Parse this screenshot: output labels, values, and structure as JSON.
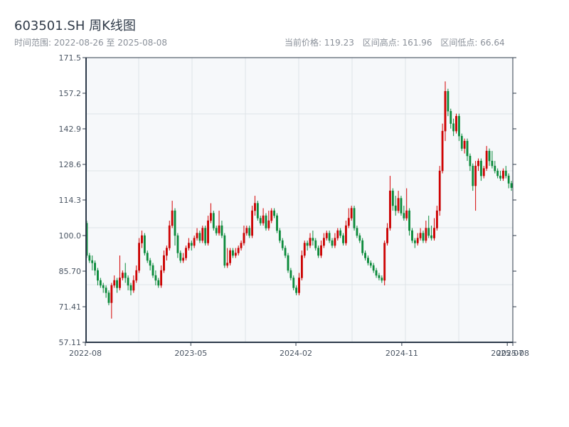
{
  "header": {
    "title": "603501.SH 周K线图",
    "range_label": "时间范围: 2022-08-26 至 2025-08-08",
    "current_price": "当前价格: 119.23",
    "range_high": "区间高点: 161.96",
    "range_low": "区间低点: 66.64"
  },
  "colors": {
    "up": "#d40000",
    "down": "#0a8a3a",
    "plot_bg": "#f6f8fa",
    "axis": "#2d3a4a",
    "grid": "#dfe3e8"
  },
  "chart_data": {
    "type": "candlestick",
    "title": "603501.SH 周K线图",
    "start_date": "2022-08-26",
    "end_date": "2025-08-08",
    "ylim": [
      57.11,
      171.5
    ],
    "y_ticks": [
      "171.5",
      "157.2",
      "142.9",
      "128.6",
      "114.3",
      "100.0",
      "85.70",
      "71.41",
      "57.11"
    ],
    "x_ticks": [
      {
        "label": "2022-08",
        "date": "2022-08-26"
      },
      {
        "label": "2023-05",
        "date": "2023-05-19"
      },
      {
        "label": "2024-02",
        "date": "2024-02-08"
      },
      {
        "label": "2024-11",
        "date": "2024-11-01"
      },
      {
        "label": "2025-07",
        "date": "2025-07-25"
      },
      {
        "label": "2025-08",
        "date": "2025-08-08"
      }
    ],
    "grid": true,
    "ohlc_format": [
      "open",
      "close",
      "low",
      "high"
    ],
    "candles": [
      [
        105,
        92,
        91,
        106
      ],
      [
        92,
        90,
        89,
        93
      ],
      [
        90,
        89,
        86,
        92
      ],
      [
        89,
        86,
        84,
        90
      ],
      [
        86,
        82,
        80,
        87
      ],
      [
        82,
        80,
        79,
        83
      ],
      [
        80,
        79,
        77,
        81
      ],
      [
        79,
        77,
        75,
        80
      ],
      [
        77,
        73,
        72,
        78
      ],
      [
        73,
        80,
        66.64,
        81
      ],
      [
        80,
        82,
        79,
        84
      ],
      [
        82,
        79,
        77,
        83
      ],
      [
        79,
        83,
        78,
        92
      ],
      [
        83,
        85,
        82,
        86
      ],
      [
        85,
        83,
        81,
        89
      ],
      [
        83,
        80,
        78,
        84
      ],
      [
        80,
        78,
        76,
        81
      ],
      [
        78,
        82,
        77,
        84
      ],
      [
        82,
        86,
        81,
        88
      ],
      [
        86,
        97,
        85,
        99
      ],
      [
        97,
        100,
        95,
        102
      ],
      [
        100,
        93,
        92,
        101
      ],
      [
        93,
        90,
        89,
        94
      ],
      [
        90,
        88,
        86,
        91
      ],
      [
        88,
        84,
        83,
        89
      ],
      [
        84,
        82,
        80,
        86
      ],
      [
        82,
        80,
        79,
        83
      ],
      [
        80,
        86,
        79,
        88
      ],
      [
        86,
        92,
        85,
        94
      ],
      [
        92,
        95,
        90,
        96
      ],
      [
        95,
        104,
        94,
        106
      ],
      [
        104,
        110,
        103,
        114
      ],
      [
        110,
        100,
        96,
        111
      ],
      [
        100,
        93,
        91,
        101
      ],
      [
        93,
        90,
        89,
        94
      ],
      [
        90,
        91,
        89,
        93
      ],
      [
        91,
        95,
        90,
        96
      ],
      [
        95,
        97,
        94,
        99
      ],
      [
        97,
        96,
        94,
        98
      ],
      [
        96,
        99,
        95,
        100
      ],
      [
        99,
        101,
        98,
        103
      ],
      [
        101,
        98,
        97,
        102
      ],
      [
        98,
        103,
        97,
        104
      ],
      [
        103,
        97,
        96,
        104
      ],
      [
        97,
        106,
        96,
        108
      ],
      [
        106,
        109,
        105,
        113
      ],
      [
        109,
        103,
        102,
        110
      ],
      [
        103,
        101,
        100,
        104
      ],
      [
        101,
        104,
        100,
        110
      ],
      [
        104,
        100,
        99,
        106
      ],
      [
        100,
        88,
        87,
        101
      ],
      [
        88,
        89,
        87,
        95
      ],
      [
        89,
        94,
        88,
        95
      ],
      [
        94,
        92,
        91,
        95
      ],
      [
        92,
        93,
        91,
        95
      ],
      [
        93,
        95,
        92,
        96
      ],
      [
        95,
        97,
        94,
        98
      ],
      [
        97,
        101,
        96,
        104
      ],
      [
        101,
        103,
        100,
        104
      ],
      [
        103,
        100,
        99,
        104
      ],
      [
        100,
        110,
        99,
        112
      ],
      [
        110,
        113,
        108,
        116
      ],
      [
        113,
        107,
        106,
        114
      ],
      [
        107,
        105,
        104,
        108
      ],
      [
        105,
        108,
        104,
        111
      ],
      [
        108,
        103,
        102,
        109
      ],
      [
        103,
        106,
        102,
        110
      ],
      [
        106,
        110,
        105,
        111
      ],
      [
        110,
        108,
        107,
        111
      ],
      [
        108,
        102,
        101,
        109
      ],
      [
        102,
        98,
        97,
        103
      ],
      [
        98,
        95,
        94,
        99
      ],
      [
        95,
        92,
        91,
        96
      ],
      [
        92,
        86,
        85,
        93
      ],
      [
        86,
        83,
        82,
        87
      ],
      [
        83,
        79,
        78,
        84
      ],
      [
        79,
        77,
        76,
        80
      ],
      [
        77,
        83,
        76,
        85
      ],
      [
        83,
        92,
        82,
        94
      ],
      [
        92,
        97,
        91,
        98
      ],
      [
        97,
        96,
        94,
        98
      ],
      [
        96,
        99,
        95,
        101
      ],
      [
        99,
        98,
        96,
        102
      ],
      [
        98,
        95,
        94,
        99
      ],
      [
        95,
        92,
        91,
        96
      ],
      [
        92,
        96,
        91,
        98
      ],
      [
        96,
        99,
        95,
        101
      ],
      [
        99,
        101,
        98,
        102
      ],
      [
        101,
        98,
        97,
        102
      ],
      [
        98,
        96,
        95,
        99
      ],
      [
        96,
        99,
        95,
        101
      ],
      [
        99,
        102,
        98,
        103
      ],
      [
        102,
        100,
        99,
        103
      ],
      [
        100,
        97,
        96,
        101
      ],
      [
        97,
        104,
        96,
        106
      ],
      [
        104,
        107,
        103,
        111
      ],
      [
        107,
        111,
        106,
        112
      ],
      [
        111,
        103,
        102,
        112
      ],
      [
        103,
        100,
        99,
        104
      ],
      [
        100,
        98,
        97,
        101
      ],
      [
        98,
        93,
        92,
        99
      ],
      [
        93,
        91,
        90,
        94
      ],
      [
        91,
        89,
        88,
        92
      ],
      [
        89,
        88,
        87,
        90
      ],
      [
        88,
        86,
        85,
        89
      ],
      [
        86,
        84,
        83,
        87
      ],
      [
        84,
        83,
        82,
        85
      ],
      [
        83,
        82,
        81,
        84
      ],
      [
        82,
        97,
        80,
        98
      ],
      [
        97,
        103,
        96,
        105
      ],
      [
        103,
        118,
        102,
        124
      ],
      [
        118,
        112,
        110,
        119
      ],
      [
        112,
        110,
        108,
        116
      ],
      [
        110,
        115,
        109,
        118
      ],
      [
        115,
        109,
        108,
        116
      ],
      [
        109,
        107,
        106,
        112
      ],
      [
        107,
        110,
        106,
        119
      ],
      [
        110,
        102,
        100,
        111
      ],
      [
        102,
        98,
        97,
        103
      ],
      [
        98,
        97,
        95,
        99
      ],
      [
        97,
        99,
        96,
        101
      ],
      [
        99,
        101,
        98,
        103
      ],
      [
        101,
        98,
        97,
        102
      ],
      [
        98,
        103,
        97,
        106
      ],
      [
        103,
        100,
        99,
        108
      ],
      [
        100,
        99,
        98,
        104
      ],
      [
        99,
        103,
        98,
        107
      ],
      [
        103,
        110,
        102,
        112
      ],
      [
        110,
        126,
        108,
        128
      ],
      [
        126,
        142,
        125,
        145
      ],
      [
        142,
        158,
        138,
        161.96
      ],
      [
        158,
        150,
        148,
        159
      ],
      [
        150,
        145,
        143,
        151
      ],
      [
        145,
        142,
        140,
        147
      ],
      [
        142,
        148,
        141,
        149
      ],
      [
        148,
        140,
        138,
        149
      ],
      [
        140,
        135,
        134,
        141
      ],
      [
        135,
        138,
        133,
        139
      ],
      [
        138,
        132,
        130,
        139
      ],
      [
        132,
        128,
        126,
        133
      ],
      [
        128,
        120,
        118,
        129
      ],
      [
        120,
        128,
        110,
        130
      ],
      [
        128,
        130,
        126,
        131
      ],
      [
        130,
        124,
        122,
        131
      ],
      [
        124,
        127,
        123,
        128
      ],
      [
        127,
        134,
        126,
        136
      ],
      [
        134,
        130,
        128,
        135
      ],
      [
        130,
        128,
        127,
        134
      ],
      [
        128,
        126,
        125,
        130
      ],
      [
        126,
        124,
        123,
        127
      ],
      [
        124,
        123,
        122,
        126
      ],
      [
        123,
        126,
        122,
        127
      ],
      [
        126,
        124,
        123,
        128
      ],
      [
        124,
        121,
        119,
        125
      ],
      [
        121,
        119.23,
        118,
        122
      ]
    ]
  }
}
